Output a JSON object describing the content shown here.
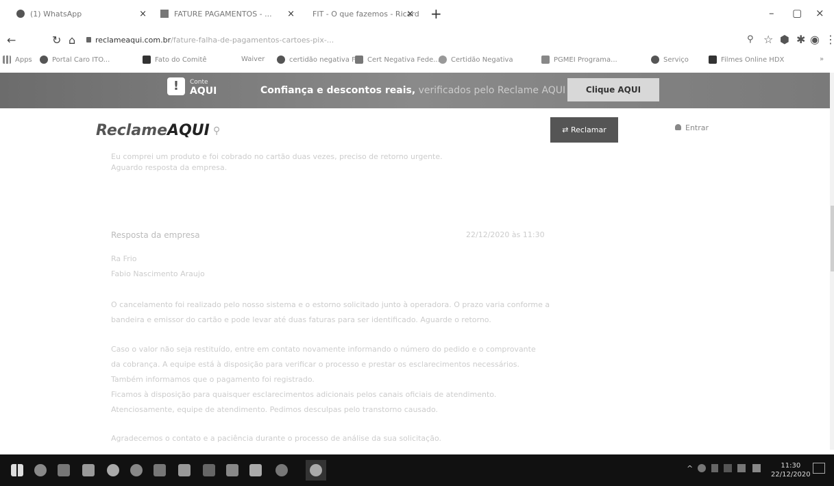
{
  "browser": {
    "tabs": [
      {
        "label": "(1) WhatsApp"
      },
      {
        "label": "FATURE PAGAMENTOS - ..."
      },
      {
        "label": "FIT - O que fazemos - Ricard"
      }
    ],
    "tab_close": "×",
    "new_tab": "+",
    "window": {
      "minimize": "–",
      "maximize": "▢",
      "close": "×"
    },
    "nav": {
      "back": "←",
      "reload": "↻",
      "home": "⌂"
    },
    "url_host": "reclameaqui.com.br",
    "url_path": "/fature-falha-de-pagamentos-cartoes-pix-...",
    "bookmarks": [
      {
        "label": "Apps"
      },
      {
        "label": "Portal Caro ITO..."
      },
      {
        "label": "Fato do Comitê"
      },
      {
        "label": "Waiver"
      },
      {
        "label": "certidão negativa FI..."
      },
      {
        "label": "Cert Negativa Fede..."
      },
      {
        "label": "Certidão Negativa"
      },
      {
        "label": "PGMEI Programa..."
      },
      {
        "label": "Serviço"
      },
      {
        "label": "Filmes Online HDX"
      }
    ],
    "bookmarks_more": "»"
  },
  "promo": {
    "logo_glyph": "!",
    "brand_top": "Conte",
    "brand_bottom": "AQUI",
    "headline": "Confiança e descontos reais,",
    "headline_soft": " verificados pelo Reclame AQUI",
    "cta_label": "Clique AQUI"
  },
  "site": {
    "logo_part1": "Reclame",
    "logo_part2": "AQUI",
    "reclamar_label": "⇄ Reclamar",
    "entrar_label": "Entrar"
  },
  "content": {
    "intro_lines": [
      "Eu comprei um produto e foi cobrado no cartão duas vezes, preciso de retorno urgente.",
      "Aguardo resposta da empresa."
    ],
    "response_heading": "Resposta da empresa",
    "response_date": "22/12/2020 às 11:30",
    "greeting": "Ra Frio",
    "signature_line": "Fabio Nascimento Araujo",
    "paragraphs": [
      "O cancelamento foi realizado pelo nosso sistema e o estorno solicitado junto à operadora. O prazo varia conforme a",
      "bandeira e emissor do cartão e pode levar até duas faturas para ser identificado. Aguarde o retorno.",
      "Caso o valor não seja restituído, entre em contato novamente informando o número do pedido e o comprovante",
      "da cobrança. A equipe está à disposição para verificar o processo e prestar os esclarecimentos necessários.",
      "Também informamos que o pagamento foi registrado.",
      "Ficamos à disposição para quaisquer esclarecimentos adicionais pelos canais oficiais de atendimento.",
      "Atenciosamente, equipe de atendimento. Pedimos desculpas pelo transtorno causado.",
      "Agradecemos o contato e a paciência durante o processo de análise da sua solicitação."
    ]
  },
  "taskbar": {
    "time": "11:30",
    "date": "22/12/2020",
    "tray_up": "^"
  }
}
